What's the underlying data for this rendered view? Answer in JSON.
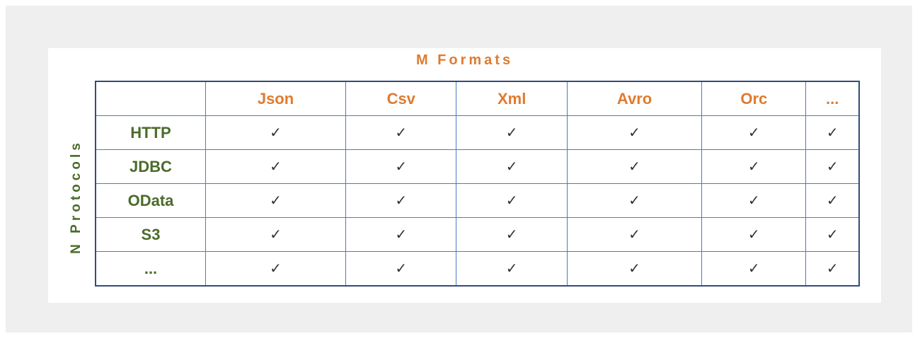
{
  "diagram": {
    "column_axis_label": "M Formats",
    "row_axis_label": "N Protocols",
    "columns": [
      "Json",
      "Csv",
      "Xml",
      "Avro",
      "Orc",
      "..."
    ],
    "rows": [
      {
        "label": "HTTP",
        "cells": [
          "✓",
          "✓",
          "✓",
          "✓",
          "✓",
          "✓"
        ]
      },
      {
        "label": "JDBC",
        "cells": [
          "✓",
          "✓",
          "✓",
          "✓",
          "✓",
          "✓"
        ]
      },
      {
        "label": "OData",
        "cells": [
          "✓",
          "✓",
          "✓",
          "✓",
          "✓",
          "✓"
        ]
      },
      {
        "label": "S3",
        "cells": [
          "✓",
          "✓",
          "✓",
          "✓",
          "✓",
          "✓"
        ]
      },
      {
        "label": "...",
        "cells": [
          "✓",
          "✓",
          "✓",
          "✓",
          "✓",
          "✓"
        ]
      }
    ]
  },
  "colors": {
    "header_orange": "#e07b2e",
    "row_green": "#4a6b2a",
    "grid_blue": "#4e79c2",
    "outer_border": "#354b78"
  }
}
